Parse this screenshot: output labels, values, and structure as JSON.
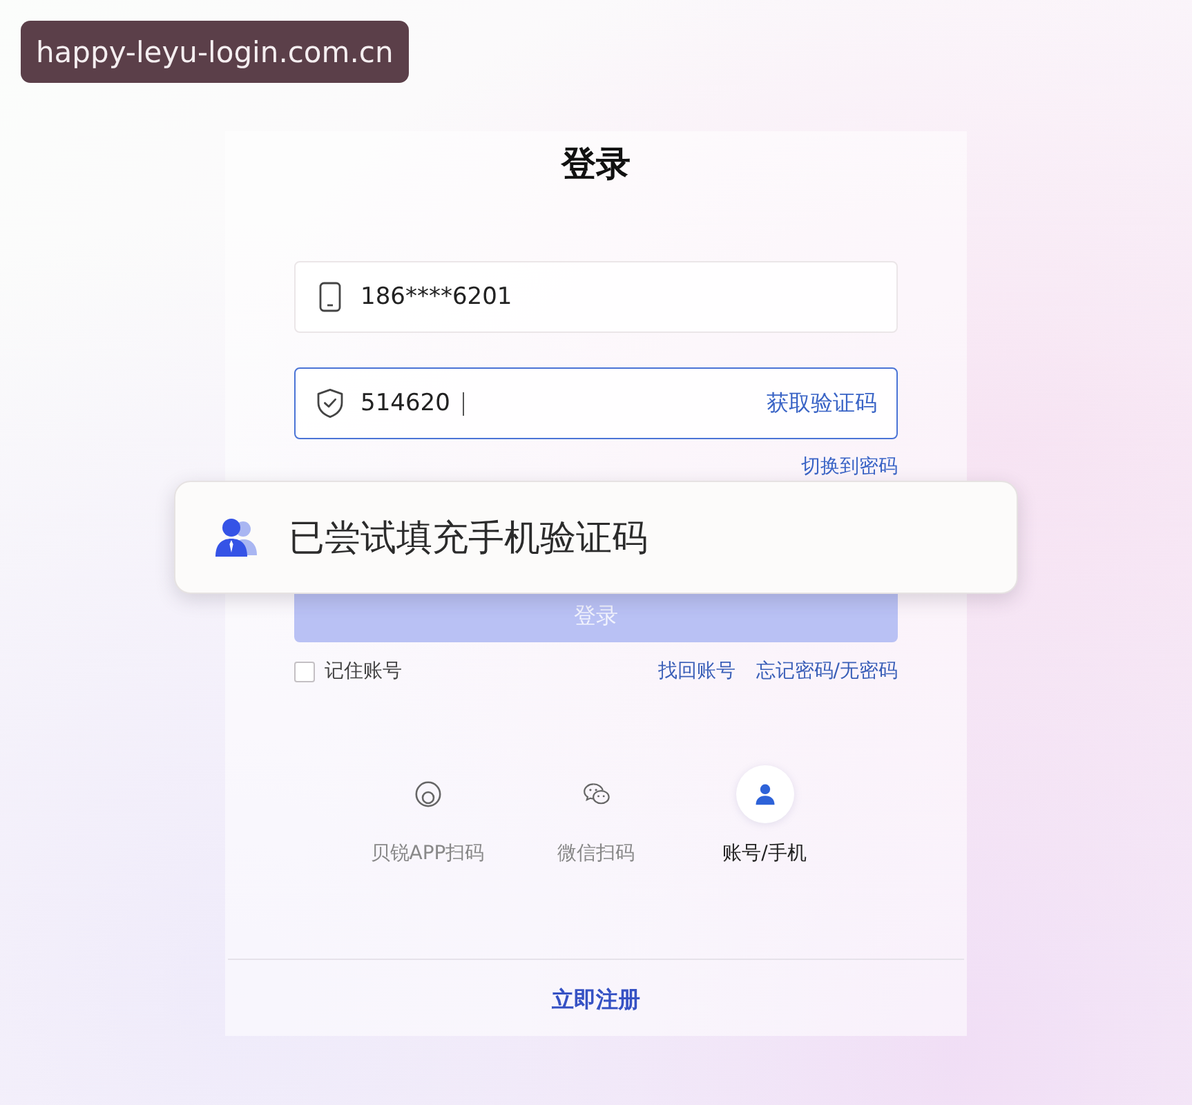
{
  "address_label": "happy-leyu-login.com.cn",
  "title": "登录",
  "phone_field": {
    "value": "186****6201"
  },
  "code_field": {
    "value": "514620",
    "focused": true,
    "action": "获取验证码"
  },
  "switch_link": "切换到密码",
  "toast": {
    "message": "已尝试填充手机验证码"
  },
  "login_button": {
    "label": "登录",
    "disabled": true
  },
  "remember": {
    "label": "记住账号",
    "checked": false
  },
  "links": [
    "找回账号",
    "忘记密码/无密码"
  ],
  "login_methods": [
    {
      "kind": "app-scan",
      "label": "贝锐APP扫码",
      "selected": false
    },
    {
      "kind": "wechat",
      "label": "微信扫码",
      "selected": false
    },
    {
      "kind": "account",
      "label": "账号/手机",
      "selected": true
    }
  ],
  "register_link": "立即注册"
}
